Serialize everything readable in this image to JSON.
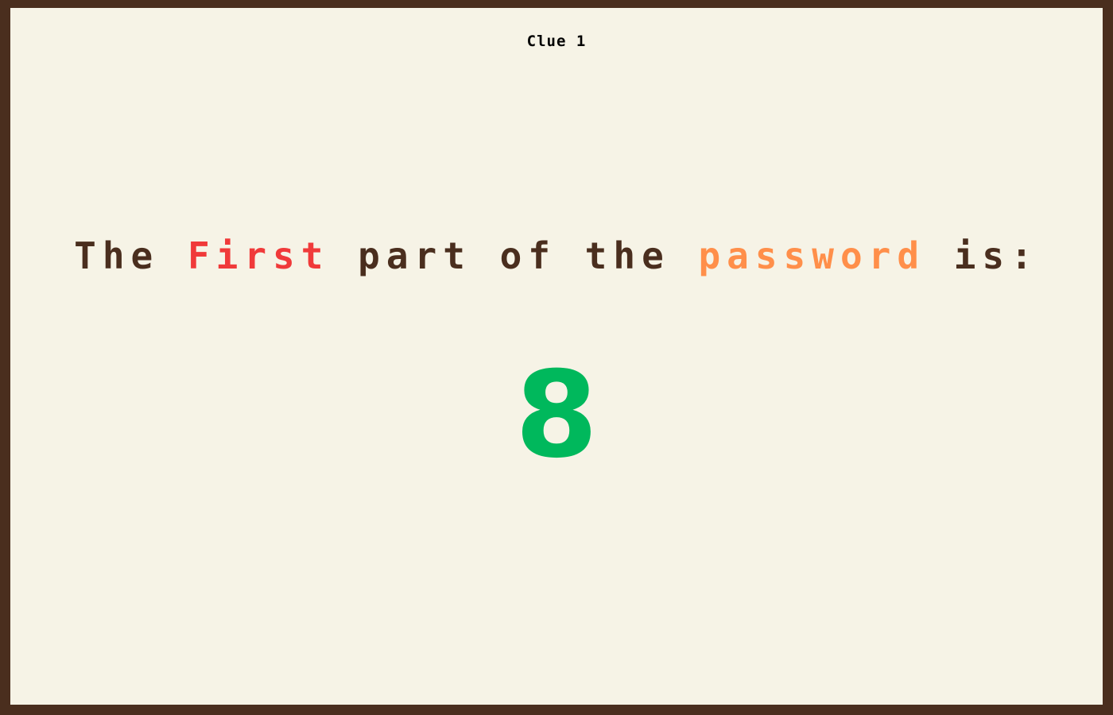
{
  "clue": {
    "title": "Clue 1"
  },
  "message": {
    "part1": "The ",
    "highlight1": "First",
    "part2": " part of the ",
    "highlight2": "password",
    "part3": " is:"
  },
  "answer": {
    "value": "8"
  },
  "colors": {
    "frame": "#4a2e1e",
    "background": "#f6f3e6",
    "text": "#4a2e1e",
    "highlight_first": "#f03a3a",
    "highlight_password": "#ff8f4a",
    "answer": "#00b85c"
  }
}
